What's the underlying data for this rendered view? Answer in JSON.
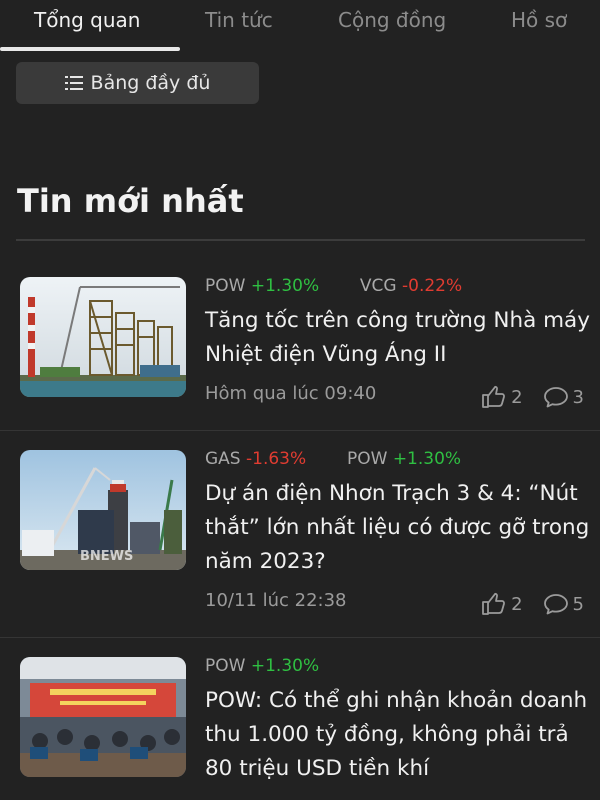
{
  "tabs": [
    {
      "label": "Tổng quan",
      "active": true
    },
    {
      "label": "Tin tức",
      "active": false
    },
    {
      "label": "Cộng đồng",
      "active": false
    },
    {
      "label": "Hồ sơ",
      "active": false
    }
  ],
  "full_table_button": {
    "label": "Bảng đầy đủ",
    "icon": "list-icon"
  },
  "section": {
    "title": "Tin mới nhất"
  },
  "news": [
    {
      "tickers": [
        {
          "symbol": "POW",
          "change": "+1.30%",
          "direction": "up"
        },
        {
          "symbol": "VCG",
          "change": "-0.22%",
          "direction": "down"
        }
      ],
      "headline": "Tăng tốc trên công trường Nhà máy Nhiệt điện Vũng Áng II",
      "time": "Hôm qua lúc 09:40",
      "likes": "2",
      "comments": "3"
    },
    {
      "tickers": [
        {
          "symbol": "GAS",
          "change": "-1.63%",
          "direction": "down"
        },
        {
          "symbol": "POW",
          "change": "+1.30%",
          "direction": "up"
        }
      ],
      "headline": "Dự án điện Nhơn Trạch 3 & 4: “Nút thắt” lớn nhất liệu có được gỡ trong năm 2023?",
      "time": "10/11 lúc 22:38",
      "likes": "2",
      "comments": "5",
      "thumb_watermark": "BNEWS"
    },
    {
      "tickers": [
        {
          "symbol": "POW",
          "change": "+1.30%",
          "direction": "up"
        }
      ],
      "headline": "POW: Có thể ghi nhận khoản doanh thu 1.000 tỷ đồng, không phải trả 80 triệu USD tiền khí"
    }
  ],
  "colors": {
    "background": "#222222",
    "up": "#2fbf42",
    "down": "#e03c31",
    "muted": "#9b9b9b"
  }
}
